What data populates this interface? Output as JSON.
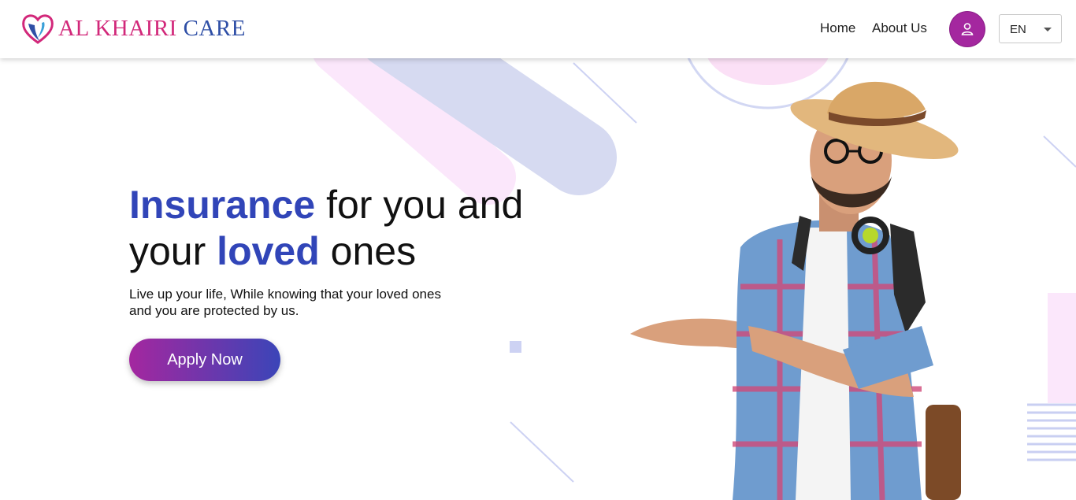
{
  "header": {
    "brand_word1": "AL KHAIRI",
    "brand_word2": "CARE",
    "nav": {
      "home": "Home",
      "about": "About Us"
    },
    "language": "EN"
  },
  "hero": {
    "title_accent1": "Insurance",
    "title_rest1": " for you and",
    "title_start2": "your ",
    "title_accent2": "loved",
    "title_rest2": " ones",
    "subtitle_line1": "Live up your life, While knowing that your loved ones",
    "subtitle_line2": "and you are protected by us.",
    "cta": "Apply Now"
  },
  "colors": {
    "accent_blue": "#3145b8",
    "accent_purple": "#a4279f",
    "brand_pink": "#d2287a",
    "brand_blue": "#2f4fa6"
  },
  "icons": [
    "heart-hands-logo-icon",
    "user-icon",
    "chevron-down-icon"
  ]
}
